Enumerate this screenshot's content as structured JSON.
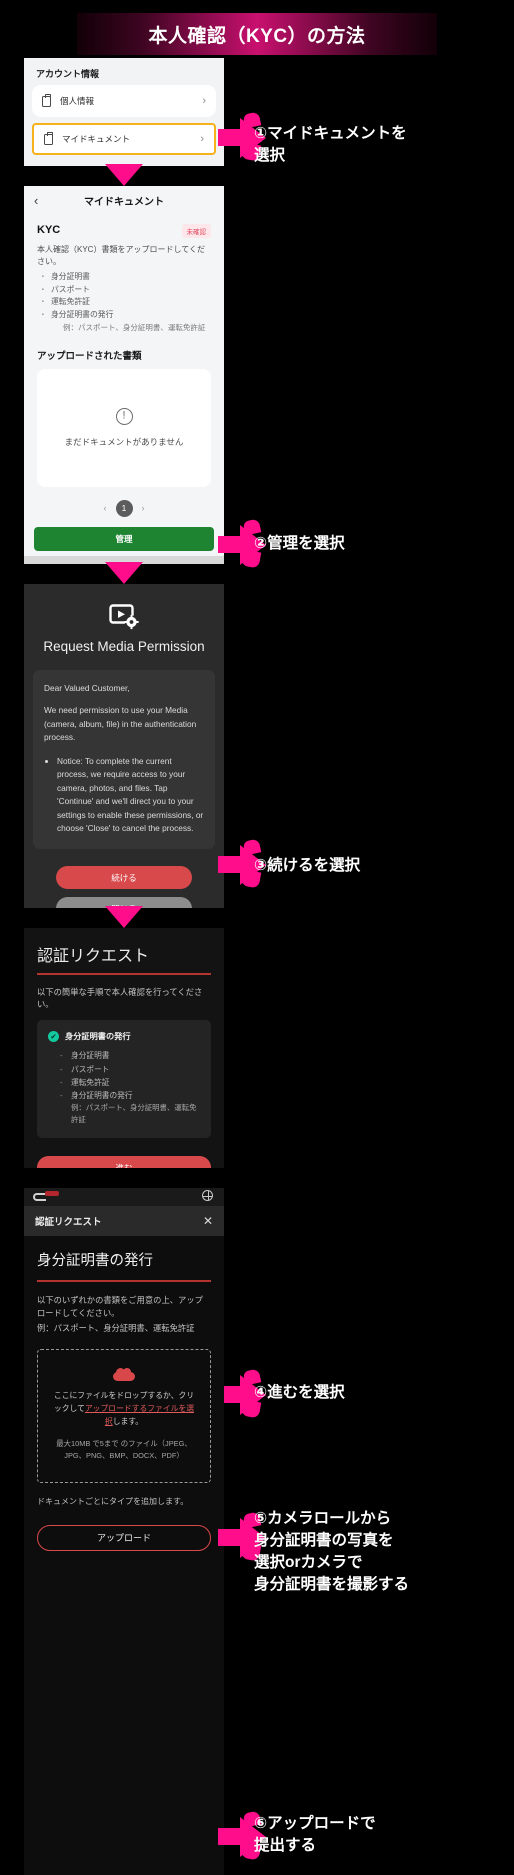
{
  "banner": {
    "title": "本人確認（KYC）の方法"
  },
  "panel1": {
    "section_label": "アカウント情報",
    "rows": [
      {
        "label": "個人情報",
        "icon": "clipboard-icon",
        "chevron": "›"
      },
      {
        "label": "マイドキュメント",
        "icon": "document-icon",
        "chevron": "›"
      }
    ]
  },
  "panel2": {
    "back_icon": "chevron-left-icon",
    "title": "マイドキュメント",
    "kyc_heading": "KYC",
    "status_badge": "未確認",
    "description": "本人確認（KYC）書類をアップロードしてください。",
    "doc_types": [
      "身分証明書",
      "パスポート",
      "運転免許証",
      "身分証明書の発行"
    ],
    "doc_example": "例：パスポート、身分証明書、運転免許証",
    "uploaded_heading": "アップロードされた書類",
    "empty_icon": "exclamation-circle-icon",
    "empty_text": "まだドキュメントがありません",
    "pager": {
      "prev": "‹",
      "page": "1",
      "next": "›"
    },
    "manage_button": "管理"
  },
  "panel3": {
    "icon": "media-permission-icon",
    "title": "Request Media Permission",
    "greeting": "Dear Valued Customer,",
    "paragraph": "We need permission to use your Media (camera, album, file) in the authentication process.",
    "bullets": [
      "Notice: To complete the current process, we require access to your camera, photos, and files. Tap 'Continue' and we'll direct you to your settings to enable these permissions, or choose 'Close' to cancel the process."
    ],
    "continue_button": "続ける",
    "close_button": "閉じる"
  },
  "panel4": {
    "title": "認証リクエスト",
    "description": "以下の簡単な手順で本人確認を行ってください。",
    "card_title": "身分証明書の発行",
    "card_check_icon": "check-circle-icon",
    "card_items": [
      "身分証明書",
      "パスポート",
      "運転免許証",
      "身分証明書の発行"
    ],
    "card_example": "例：パスポート、身分証明書、運転免許証",
    "proceed_button": "進む"
  },
  "panel5": {
    "globe_icon": "globe-icon",
    "modal_title": "認証リクエスト",
    "close_icon": "✕",
    "heading": "身分証明書の発行",
    "description_line1": "以下のいずれかの書類をご用意の上、アップロードしてください。",
    "description_line2": "例：パスポート、身分証明書、運転免許証",
    "cloud_icon": "cloud-upload-icon",
    "dropzone_text_before": "ここにファイルをドロップするか、クリックして",
    "dropzone_link": "アップロードするファイルを選択",
    "dropzone_text_after": "します。",
    "dropzone_note": "最大10MB で5まで のファイル（JPEG、JPG、PNG、BMP、DOCX、PDF）",
    "footer_note": "ドキュメントごとにタイプを追加します。",
    "upload_button": "アップロード"
  },
  "callouts": [
    {
      "text": "①マイドキュメントを\n選択"
    },
    {
      "text": "②管理を選択"
    },
    {
      "text": "③続けるを選択"
    },
    {
      "text": "④進むを選択"
    },
    {
      "text": "⑤カメラロールから\n身分証明書の写真を\n選択orカメラで\n身分証明書を撮影する"
    },
    {
      "text": "⑥アップロードで\n提出する"
    }
  ],
  "colors": {
    "accent_pink": "#ff0d8b",
    "highlight_yellow": "#f5b21a",
    "green": "#1e8432",
    "red": "#d8494c",
    "teal": "#13c9a0"
  }
}
